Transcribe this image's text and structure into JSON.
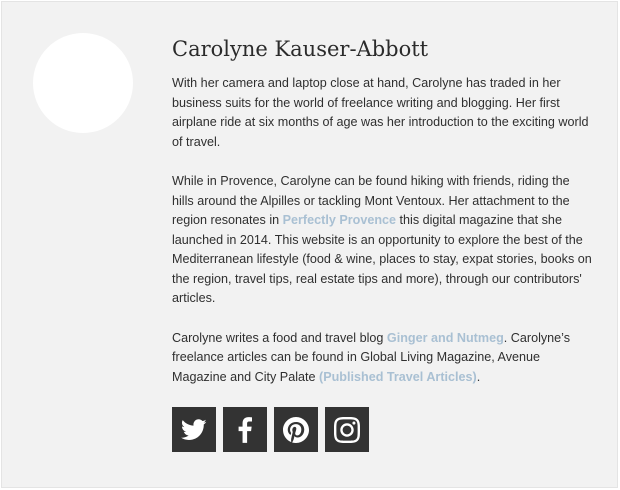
{
  "author": {
    "name": "Carolyne Kauser-Abbott",
    "bio": {
      "p1": "With her camera and laptop close at hand, Carolyne has traded in her business suits for the world of freelance writing and blogging. Her first airplane ride at six months of age was her introduction to the exciting world of travel.",
      "p2_before": "While in Provence, Carolyne can be found hiking with friends, riding the hills around the Alpilles or tackling Mont Ventoux. Her attachment to the region resonates in ",
      "p2_link": "Perfectly Provence",
      "p2_after": " this digital magazine that she launched in 2014. This website is an opportunity to explore the best of the Mediterranean lifestyle (food & wine, places to stay, expat stories, books on the region, travel tips, real estate tips and more), through our contributors' articles.",
      "p3_before": "Carolyne writes a food and travel blog ",
      "p3_link1": "Ginger and Nutmeg",
      "p3_middle": ". Carolyne’s freelance articles can be found in Global Living Magazine, Avenue Magazine and City Palate ",
      "p3_link2": "(Published Travel Articles)",
      "p3_after": "."
    },
    "social": [
      {
        "icon": "twitter-icon"
      },
      {
        "icon": "facebook-icon"
      },
      {
        "icon": "pinterest-icon"
      },
      {
        "icon": "instagram-icon"
      }
    ]
  },
  "colors": {
    "card_bg": "#f2f2f2",
    "link": "#a9c0d3",
    "social_bg": "#333333",
    "text": "#2f2f2f"
  }
}
